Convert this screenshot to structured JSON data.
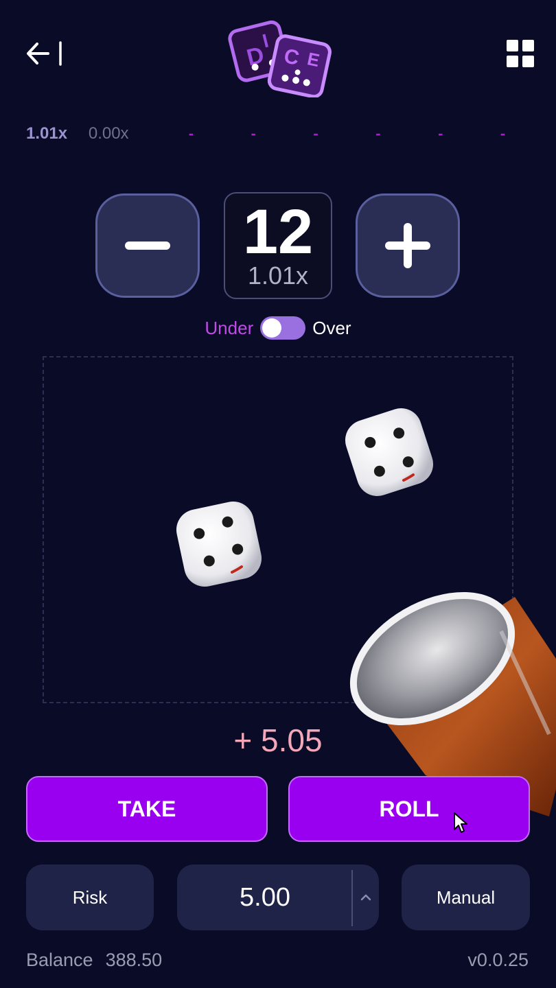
{
  "header": {
    "back_icon": "exit-arrow-icon",
    "menu_icon": "grid-menu-icon",
    "logo_letters": [
      "D",
      "I",
      "C",
      "E"
    ]
  },
  "history": {
    "current": "1.01x",
    "previous": "0.00x",
    "slots": [
      "-",
      "-",
      "-",
      "-",
      "-",
      "-"
    ]
  },
  "target": {
    "value": "12",
    "multiplier": "1.01x",
    "minus_icon": "minus-icon",
    "plus_icon": "plus-icon"
  },
  "toggle": {
    "under_label": "Under",
    "over_label": "Over",
    "selected": "Under"
  },
  "dice": [
    {
      "face": 4
    },
    {
      "face": 4
    }
  ],
  "result": {
    "win_amount": "+ 5.05"
  },
  "actions": {
    "take_label": "TAKE",
    "roll_label": "ROLL"
  },
  "controls": {
    "risk_label": "Risk",
    "bet_value": "5.00",
    "manual_label": "Manual"
  },
  "footer": {
    "balance_label": "Balance",
    "balance_value": "388.50",
    "version": "v0.0.25"
  },
  "colors": {
    "background": "#0a0b27",
    "accent": "#9a00f0",
    "history_slot": "#b01bd0",
    "win_text": "#f3a7b9"
  }
}
